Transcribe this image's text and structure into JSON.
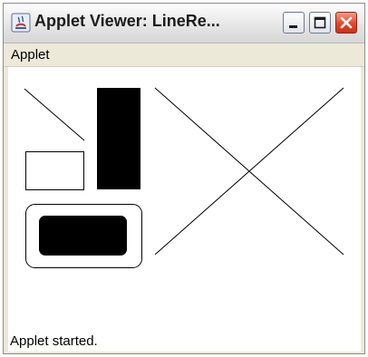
{
  "window": {
    "title": "Applet Viewer: LineRe...",
    "icon": "java-applet-icon",
    "buttons": [
      "minimize-icon",
      "maximize-icon",
      "close-icon"
    ]
  },
  "menubar": {
    "items": [
      {
        "label": "Applet"
      }
    ]
  },
  "canvas": {
    "shapes": [
      "diagonal-line",
      "filled-rectangle",
      "outline-rectangle",
      "outline-rounded-rectangle",
      "filled-rounded-rectangle",
      "x-cross-lines"
    ]
  },
  "status": {
    "text": "Applet started."
  },
  "colors": {
    "close_button": "#e3482a",
    "chrome": "#ece9d8",
    "canvas": "#ffffff",
    "ink": "#000000"
  }
}
